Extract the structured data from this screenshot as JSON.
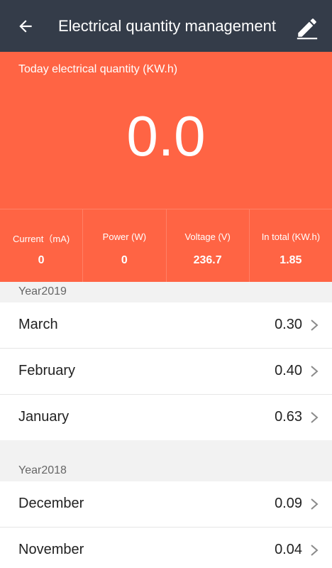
{
  "header": {
    "title": "Electrical quantity management",
    "back_icon": "arrow-left-icon",
    "edit_icon": "pencil-icon"
  },
  "today": {
    "label": "Today electrical quantity (KW.h)",
    "value": "0.0"
  },
  "stats": [
    {
      "label": "Current（mA)",
      "value": "0"
    },
    {
      "label": "Power (W)",
      "value": "0"
    },
    {
      "label": "Voltage (V)",
      "value": "236.7"
    },
    {
      "label": "In total (KW.h)",
      "value": "1.85"
    }
  ],
  "years": [
    {
      "label": "Year2019",
      "months": [
        {
          "name": "March",
          "value": "0.30"
        },
        {
          "name": "February",
          "value": "0.40"
        },
        {
          "name": "January",
          "value": "0.63"
        }
      ]
    },
    {
      "label": "Year2018",
      "months": [
        {
          "name": "December",
          "value": "0.09"
        },
        {
          "name": "November",
          "value": "0.04"
        }
      ]
    }
  ],
  "colors": {
    "topbar": "#343c49",
    "accent": "#ff6444",
    "background": "#f5f5f5"
  }
}
